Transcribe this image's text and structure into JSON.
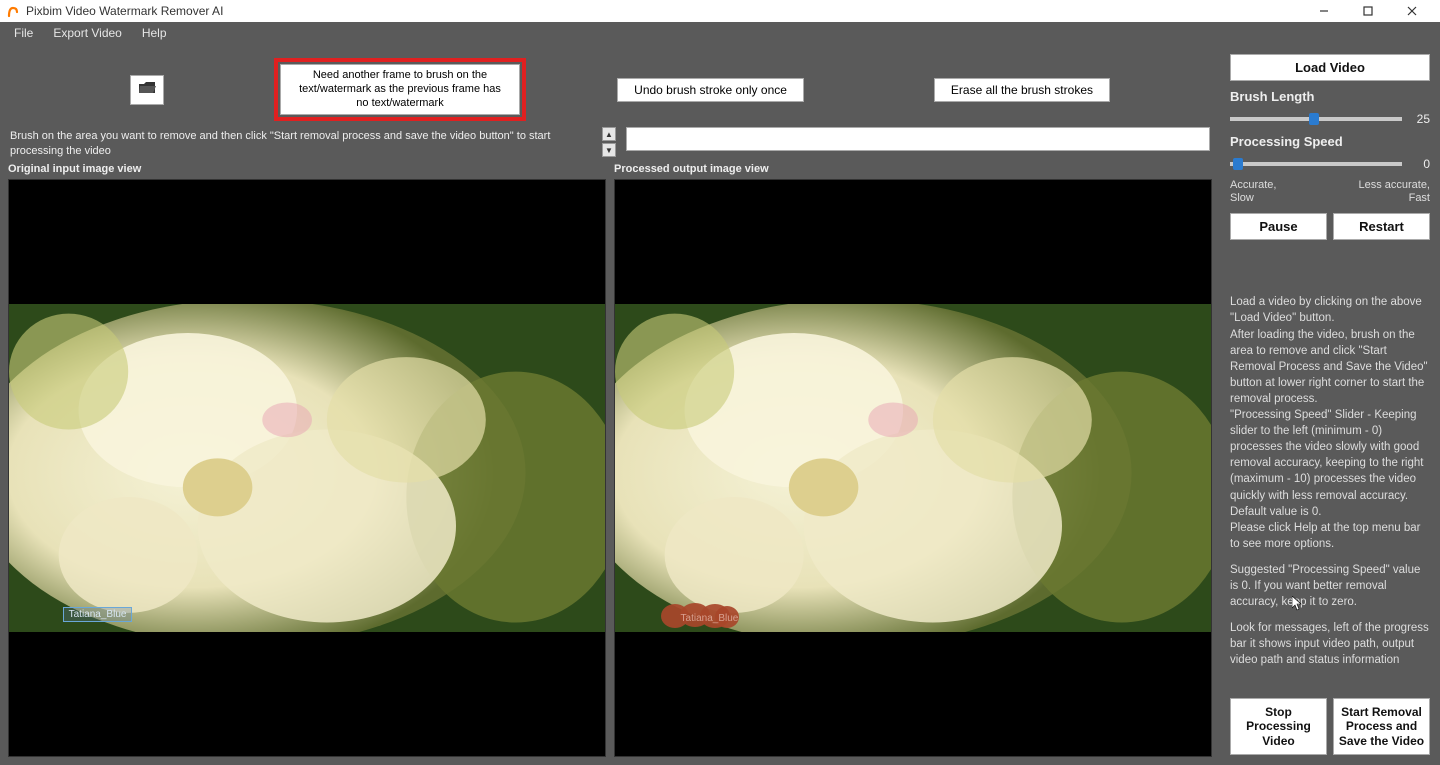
{
  "window": {
    "title": "Pixbim Video Watermark Remover AI"
  },
  "menu": {
    "file": "File",
    "export": "Export Video",
    "help": "Help"
  },
  "toolbar": {
    "need_frame_label": "Need another frame to brush on the text/watermark as the previous frame has no text/watermark",
    "undo_label": "Undo brush stroke only once",
    "erase_label": "Erase all the brush strokes"
  },
  "instruction": "Brush on the area you want to remove and then click \"Start removal process and save the video button\" to start processing the video",
  "views": {
    "left_label": "Original input image view",
    "right_label": "Processed output image view",
    "watermark_text_left": "Tatiana_Blue",
    "watermark_text_right": "Tatiana_Blue"
  },
  "sidebar": {
    "load_label": "Load Video",
    "brush_label": "Brush Length",
    "brush_value": "25",
    "brush_slider_pct": 46,
    "speed_label": "Processing Speed",
    "speed_value": "0",
    "speed_slider_pct": 2,
    "accurate_left": "Accurate,\nSlow",
    "accurate_right": "Less accurate,\nFast",
    "pause_label": "Pause",
    "restart_label": "Restart",
    "help_p1": "Load a video by clicking on the above \"Load Video\" button.",
    "help_p2": "After loading the video, brush on the area to remove and click \"Start Removal Process and Save the Video\" button at lower right corner to start the removal process.",
    "help_p3": "\"Processing Speed\" Slider - Keeping slider to the left (minimum - 0) processes the video slowly with good removal accuracy, keeping to the right (maximum - 10) processes the video quickly with less removal accuracy. Default value is 0.",
    "help_p4": "Please click Help at the top menu bar to see more options.",
    "help_p5": "Suggested \"Processing Speed\" value is 0. If you want better removal accuracy, keep it to zero.",
    "help_p6": "Look for messages, left of the progress bar it shows input video path, output video path and status information",
    "stop_label": "Stop Processing Video",
    "start_label": "Start Removal Process and Save the Video"
  }
}
